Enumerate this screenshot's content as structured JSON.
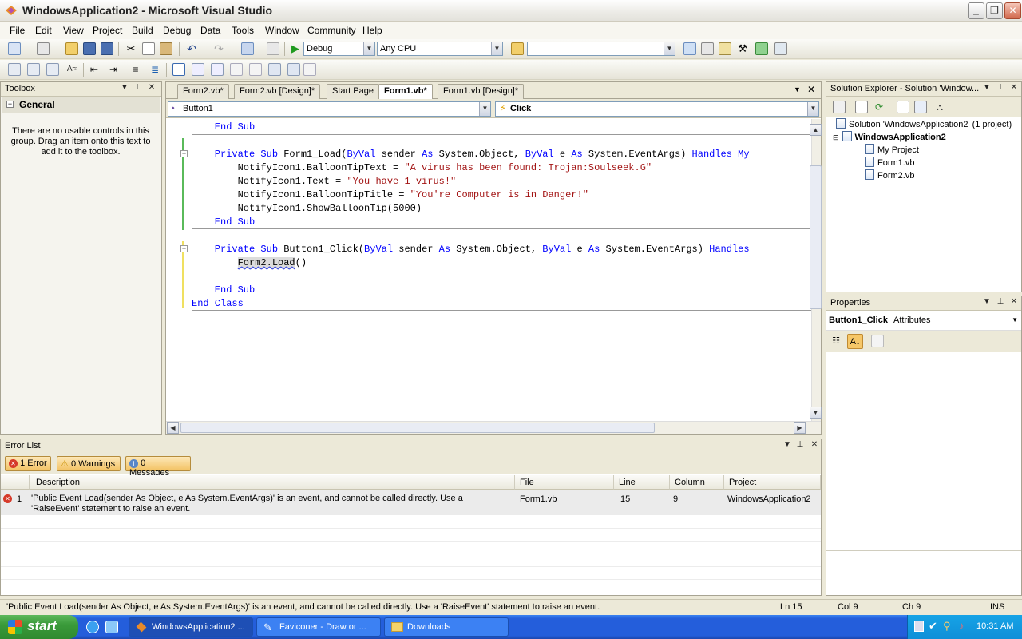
{
  "window": {
    "title": "WindowsApplication2 - Microsoft Visual Studio"
  },
  "menu": [
    "File",
    "Edit",
    "View",
    "Project",
    "Build",
    "Debug",
    "Data",
    "Tools",
    "Window",
    "Community",
    "Help"
  ],
  "toolbar": {
    "config": "Debug",
    "platform": "Any CPU",
    "find": ""
  },
  "toolbox": {
    "title": "Toolbox",
    "group": "General",
    "message": "There are no usable controls in this group. Drag an item onto this text to add it to the toolbox."
  },
  "editor": {
    "tabs": [
      "Form2.vb*",
      "Form2.vb [Design]*",
      "Start Page",
      "Form1.vb*",
      "Form1.vb [Design]*"
    ],
    "object_combo": "Button1",
    "event_combo": "Click",
    "lines": [
      {
        "parts": [
          {
            "t": "    End Sub",
            "c": "kw"
          }
        ]
      },
      {
        "parts": [
          {
            "t": "",
            "c": ""
          }
        ]
      },
      {
        "parts": [
          {
            "t": "    Private Sub ",
            "c": "kw"
          },
          {
            "t": "Form1_Load(",
            "c": ""
          },
          {
            "t": "ByVal",
            "c": "kw"
          },
          {
            "t": " sender ",
            "c": ""
          },
          {
            "t": "As",
            "c": "kw"
          },
          {
            "t": " System.Object, ",
            "c": ""
          },
          {
            "t": "ByVal",
            "c": "kw"
          },
          {
            "t": " e ",
            "c": ""
          },
          {
            "t": "As",
            "c": "kw"
          },
          {
            "t": " System.EventArgs) ",
            "c": ""
          },
          {
            "t": "Handles",
            "c": "kw"
          },
          {
            "t": " My",
            "c": "kw"
          }
        ]
      },
      {
        "parts": [
          {
            "t": "        NotifyIcon1.BalloonTipText = ",
            "c": ""
          },
          {
            "t": "\"A virus has been found: Trojan:Soulseek.G\"",
            "c": "str"
          }
        ]
      },
      {
        "parts": [
          {
            "t": "        NotifyIcon1.Text = ",
            "c": ""
          },
          {
            "t": "\"You have 1 virus!\"",
            "c": "str"
          }
        ]
      },
      {
        "parts": [
          {
            "t": "        NotifyIcon1.BalloonTipTitle = ",
            "c": ""
          },
          {
            "t": "\"You're Computer is in Danger!\"",
            "c": "str"
          }
        ]
      },
      {
        "parts": [
          {
            "t": "        NotifyIcon1.ShowBalloonTip(5000)",
            "c": ""
          }
        ]
      },
      {
        "parts": [
          {
            "t": "    End Sub",
            "c": "kw"
          }
        ]
      },
      {
        "parts": [
          {
            "t": "",
            "c": ""
          }
        ]
      },
      {
        "parts": [
          {
            "t": "    Private Sub ",
            "c": "kw"
          },
          {
            "t": "Button1_Click(",
            "c": ""
          },
          {
            "t": "ByVal",
            "c": "kw"
          },
          {
            "t": " sender ",
            "c": ""
          },
          {
            "t": "As",
            "c": "kw"
          },
          {
            "t": " System.Object, ",
            "c": ""
          },
          {
            "t": "ByVal",
            "c": "kw"
          },
          {
            "t": " e ",
            "c": ""
          },
          {
            "t": "As",
            "c": "kw"
          },
          {
            "t": " System.EventArgs) ",
            "c": ""
          },
          {
            "t": "Handles",
            "c": "kw"
          }
        ]
      },
      {
        "parts": [
          {
            "t": "        ",
            "c": ""
          },
          {
            "t": "Form2.Load",
            "c": "err"
          },
          {
            "t": "()",
            "c": ""
          }
        ]
      },
      {
        "parts": [
          {
            "t": "",
            "c": ""
          }
        ]
      },
      {
        "parts": [
          {
            "t": "    End Sub",
            "c": "kw"
          }
        ]
      },
      {
        "parts": [
          {
            "t": "End Class",
            "c": "kw"
          }
        ]
      }
    ]
  },
  "solution_explorer": {
    "title": "Solution Explorer - Solution 'Window...",
    "solution": "Solution 'WindowsApplication2' (1 project)",
    "project": "WindowsApplication2",
    "items": [
      "My Project",
      "Form1.vb",
      "Form2.vb"
    ]
  },
  "properties": {
    "title": "Properties",
    "object": "Button1_Click",
    "object_type": "Attributes"
  },
  "error_list": {
    "title": "Error List",
    "filters": {
      "errors": "1 Error",
      "warnings": "0 Warnings",
      "messages": "0 Messages"
    },
    "columns": [
      "Description",
      "File",
      "Line",
      "Column",
      "Project"
    ],
    "rows": [
      {
        "num": "1",
        "description": "'Public Event Load(sender As Object, e As System.EventArgs)' is an event, and cannot be called directly. Use a 'RaiseEvent' statement to raise an event.",
        "file": "Form1.vb",
        "line": "15",
        "column": "9",
        "project": "WindowsApplication2"
      }
    ]
  },
  "status": {
    "message": "'Public Event Load(sender As Object, e As System.EventArgs)' is an event, and cannot be called directly. Use a 'RaiseEvent' statement to raise an event.",
    "ln": "Ln 15",
    "col": "Col 9",
    "ch": "Ch 9",
    "mode": "INS"
  },
  "taskbar": {
    "start": "start",
    "tasks": [
      "WindowsApplication2 ...",
      "Faviconer - Draw or ...",
      "Downloads"
    ],
    "clock": "10:31 AM"
  }
}
